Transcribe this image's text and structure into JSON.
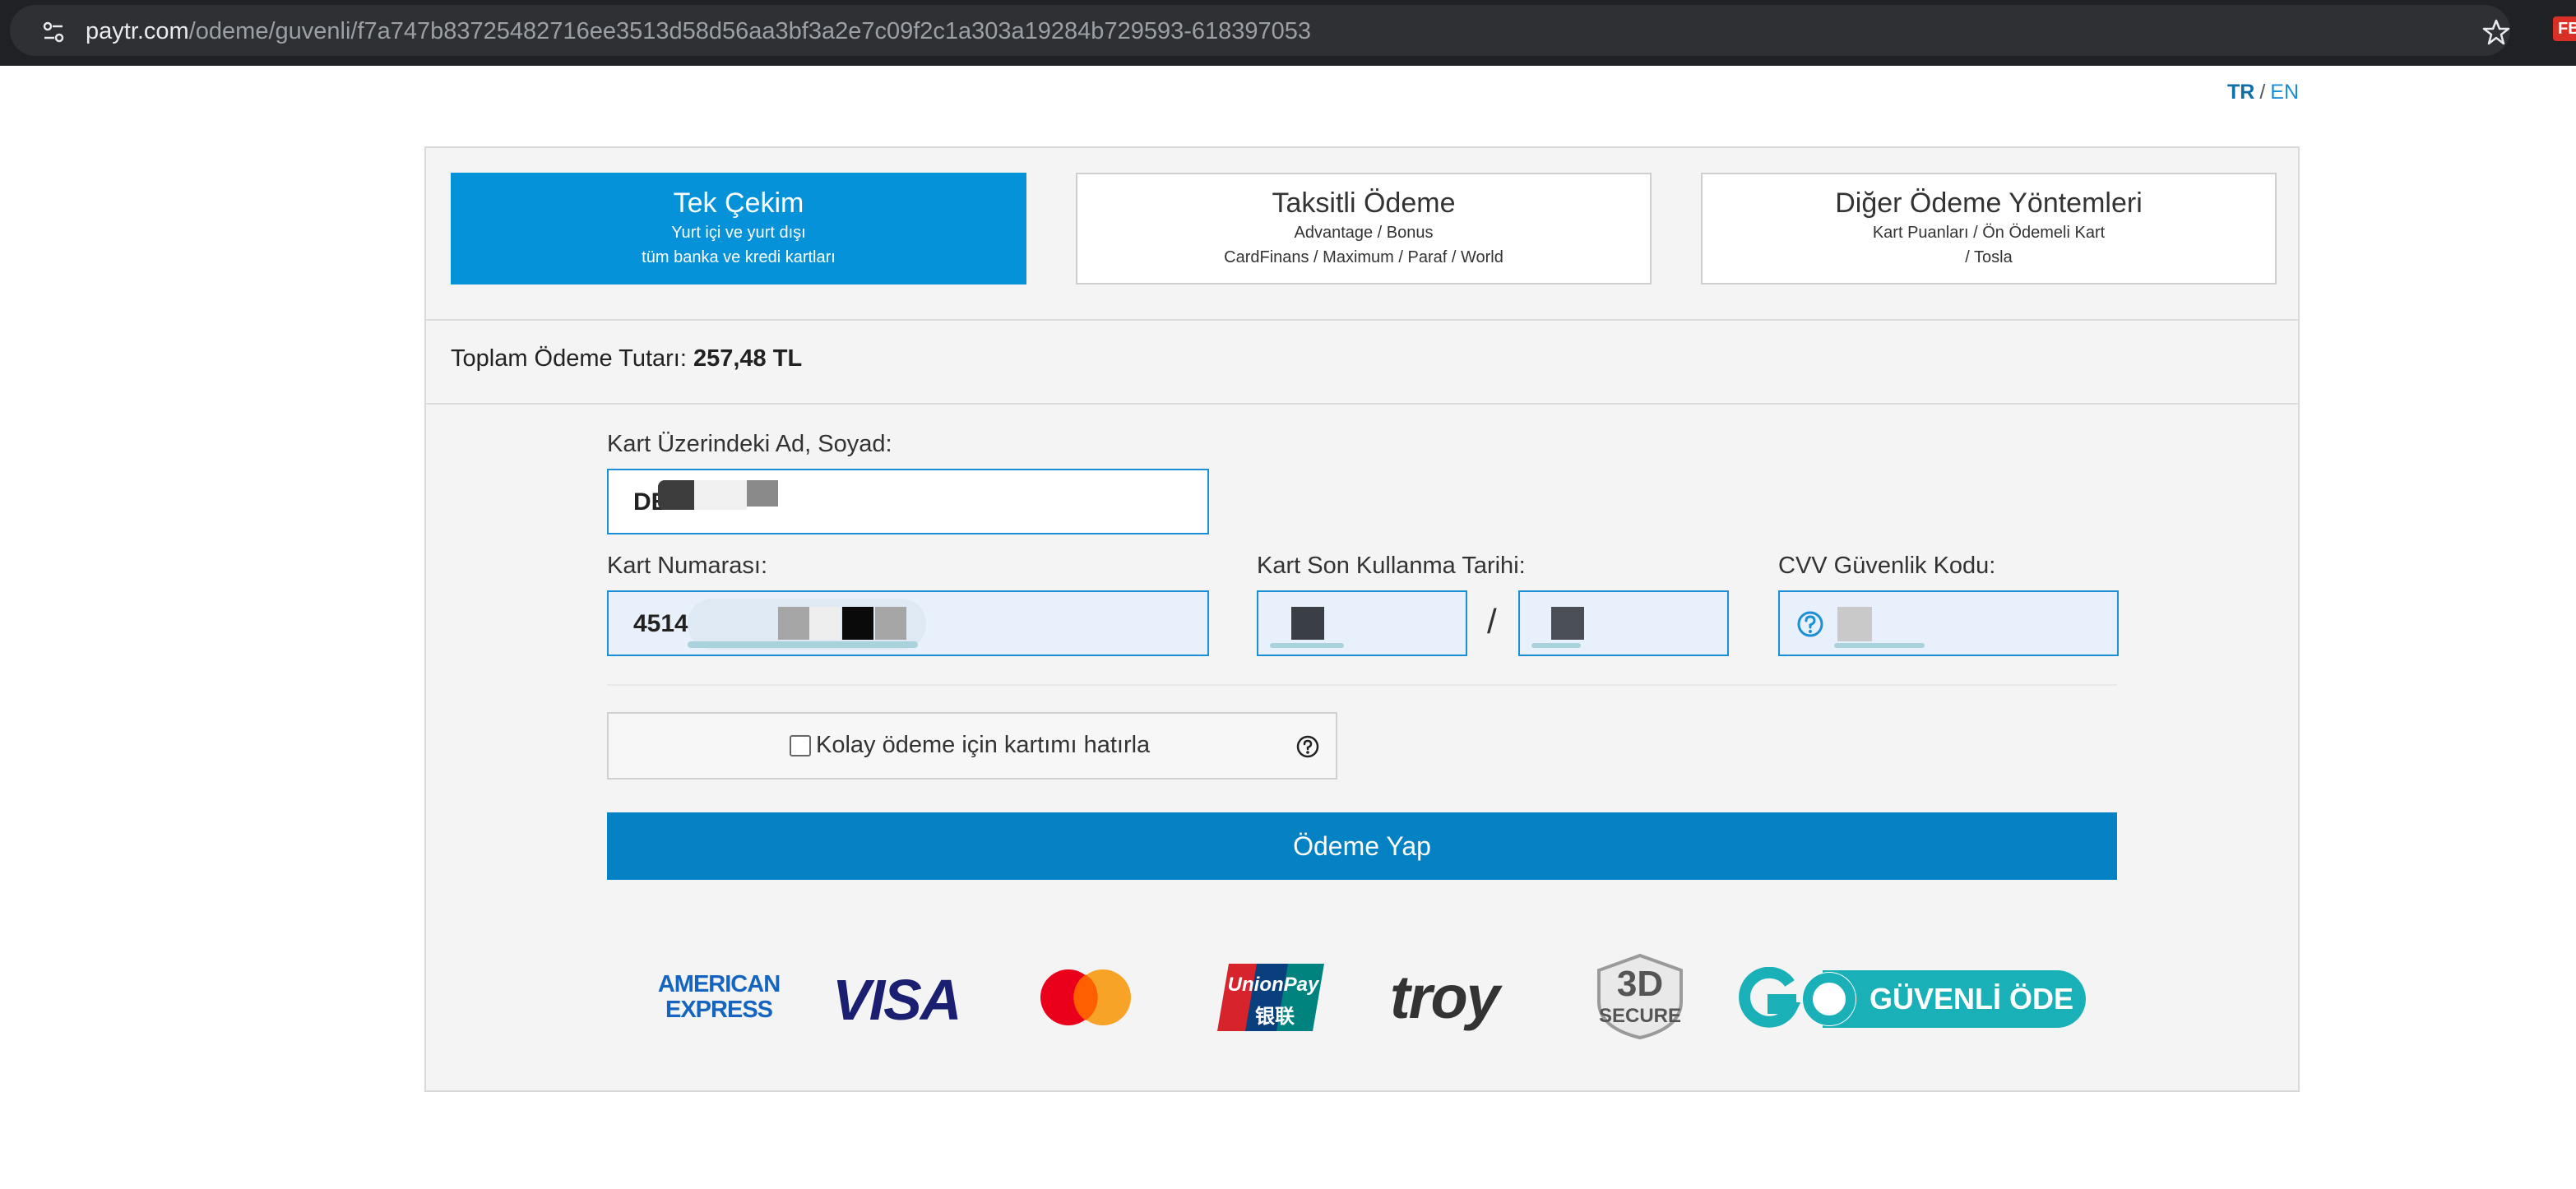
{
  "browser": {
    "url_host": "paytr.com",
    "url_path": "/odeme/guvenli/f7a747b83725482716ee3513d58d56aa3bf3a2e7c09f2c1a303a19284b729593-618397053",
    "site_icon": "tune-icon",
    "bookmark_icon": "star-icon",
    "extension_badge": "FB"
  },
  "lang": {
    "tr": "TR",
    "separator": "/",
    "en": "EN"
  },
  "tabs": [
    {
      "title": "Tek Çekim",
      "sub1": "Yurt içi ve yurt dışı",
      "sub2": "tüm banka ve kredi kartları",
      "active": true
    },
    {
      "title": "Taksitli Ödeme",
      "sub1": "Advantage / Bonus",
      "sub2": "CardFinans / Maximum / Paraf / World",
      "active": false
    },
    {
      "title": "Diğer Ödeme Yöntemleri",
      "sub1": "Kart Puanları / Ön Ödemeli Kart",
      "sub2": "/ Tosla",
      "active": false
    }
  ],
  "total": {
    "label": "Toplam Ödeme Tutarı:",
    "amount": "257,48 TL"
  },
  "form": {
    "name_label": "Kart Üzerindeki Ad, Soyad:",
    "name_value": "DE",
    "card_label": "Kart Numarası:",
    "card_value": "4514",
    "expiry_label": "Kart Son Kullanma Tarihi:",
    "expiry_separator": "/",
    "cvv_label": "CVV Güvenlik Kodu:",
    "remember_label": "Kolay ödeme için kartımı hatırla",
    "pay_button": "Ödeme Yap"
  },
  "logos": {
    "amex_line1": "AMERICAN",
    "amex_line2": "EXPRESS",
    "visa": "VISA",
    "unionpay": "UnionPay",
    "unionpay_cn": "银联",
    "troy": "troy",
    "secure_3d": "3D",
    "secure_word": "SECURE",
    "go_text": "GÜVENLİ ÖDE"
  },
  "colors": {
    "accent": "#0592d9",
    "button": "#0582c4",
    "field_border": "#1a8fd6",
    "field_fill": "#e8f0fb"
  }
}
